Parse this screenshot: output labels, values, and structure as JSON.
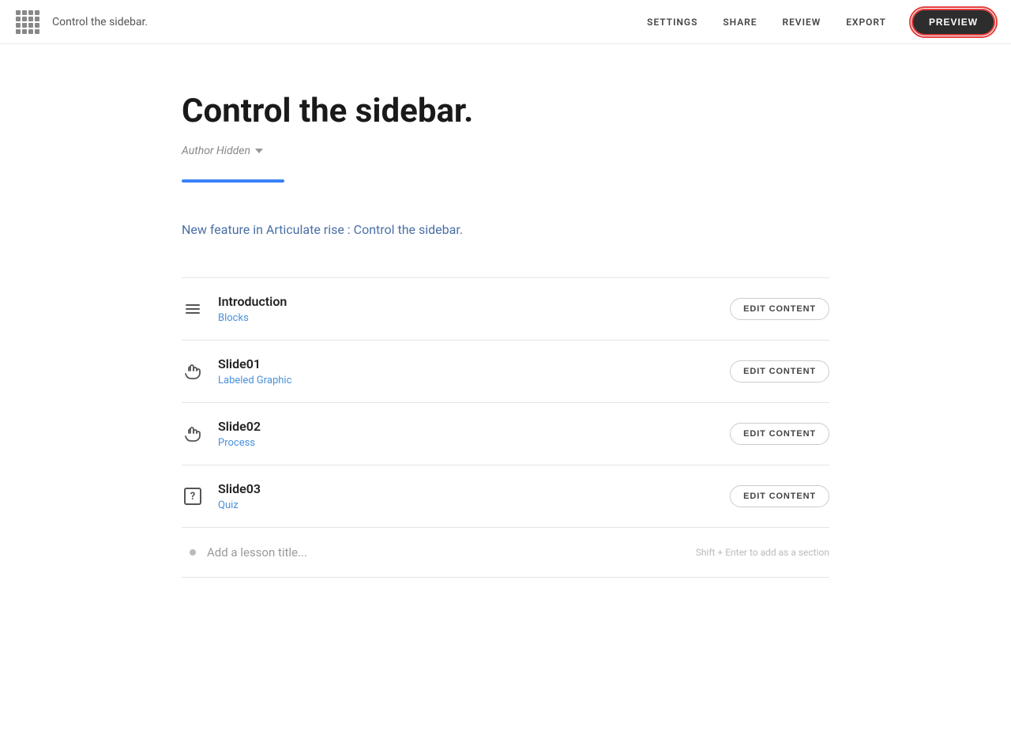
{
  "header": {
    "title": "Control the sidebar.",
    "nav": {
      "settings": "SETTINGS",
      "share": "SHARE",
      "review": "REVIEW",
      "export": "EXPORT",
      "preview": "PREVIEW"
    }
  },
  "course": {
    "title": "Control the sidebar.",
    "author": "Author Hidden",
    "description": "New feature in Articulate rise : Control the sidebar.",
    "blue_bar_color": "#3b82f6"
  },
  "lessons": [
    {
      "name": "Introduction",
      "type": "Blocks",
      "icon": "hamburger",
      "edit_label": "EDIT CONTENT"
    },
    {
      "name": "Slide01",
      "type": "Labeled Graphic",
      "icon": "touch",
      "edit_label": "EDIT CONTENT"
    },
    {
      "name": "Slide02",
      "type": "Process",
      "icon": "touch",
      "edit_label": "EDIT CONTENT"
    },
    {
      "name": "Slide03",
      "type": "Quiz",
      "icon": "quiz",
      "edit_label": "EDIT CONTENT"
    }
  ],
  "add_lesson": {
    "placeholder": "Add a lesson title...",
    "hint": "Shift + Enter to add as a section"
  }
}
